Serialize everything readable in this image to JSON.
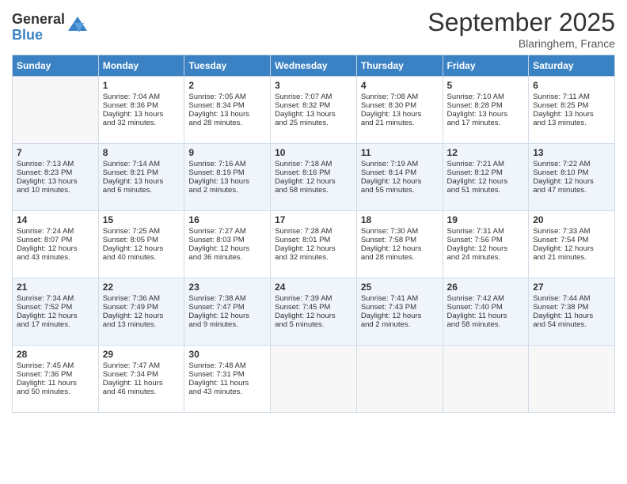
{
  "header": {
    "logo": {
      "general": "General",
      "blue": "Blue"
    },
    "month_title": "September 2025",
    "location": "Blaringhem, France"
  },
  "days_of_week": [
    "Sunday",
    "Monday",
    "Tuesday",
    "Wednesday",
    "Thursday",
    "Friday",
    "Saturday"
  ],
  "weeks": [
    [
      {
        "day": "",
        "info": ""
      },
      {
        "day": "1",
        "info": "Sunrise: 7:04 AM\nSunset: 8:36 PM\nDaylight: 13 hours\nand 32 minutes."
      },
      {
        "day": "2",
        "info": "Sunrise: 7:05 AM\nSunset: 8:34 PM\nDaylight: 13 hours\nand 28 minutes."
      },
      {
        "day": "3",
        "info": "Sunrise: 7:07 AM\nSunset: 8:32 PM\nDaylight: 13 hours\nand 25 minutes."
      },
      {
        "day": "4",
        "info": "Sunrise: 7:08 AM\nSunset: 8:30 PM\nDaylight: 13 hours\nand 21 minutes."
      },
      {
        "day": "5",
        "info": "Sunrise: 7:10 AM\nSunset: 8:28 PM\nDaylight: 13 hours\nand 17 minutes."
      },
      {
        "day": "6",
        "info": "Sunrise: 7:11 AM\nSunset: 8:25 PM\nDaylight: 13 hours\nand 13 minutes."
      }
    ],
    [
      {
        "day": "7",
        "info": "Sunrise: 7:13 AM\nSunset: 8:23 PM\nDaylight: 13 hours\nand 10 minutes."
      },
      {
        "day": "8",
        "info": "Sunrise: 7:14 AM\nSunset: 8:21 PM\nDaylight: 13 hours\nand 6 minutes."
      },
      {
        "day": "9",
        "info": "Sunrise: 7:16 AM\nSunset: 8:19 PM\nDaylight: 13 hours\nand 2 minutes."
      },
      {
        "day": "10",
        "info": "Sunrise: 7:18 AM\nSunset: 8:16 PM\nDaylight: 12 hours\nand 58 minutes."
      },
      {
        "day": "11",
        "info": "Sunrise: 7:19 AM\nSunset: 8:14 PM\nDaylight: 12 hours\nand 55 minutes."
      },
      {
        "day": "12",
        "info": "Sunrise: 7:21 AM\nSunset: 8:12 PM\nDaylight: 12 hours\nand 51 minutes."
      },
      {
        "day": "13",
        "info": "Sunrise: 7:22 AM\nSunset: 8:10 PM\nDaylight: 12 hours\nand 47 minutes."
      }
    ],
    [
      {
        "day": "14",
        "info": "Sunrise: 7:24 AM\nSunset: 8:07 PM\nDaylight: 12 hours\nand 43 minutes."
      },
      {
        "day": "15",
        "info": "Sunrise: 7:25 AM\nSunset: 8:05 PM\nDaylight: 12 hours\nand 40 minutes."
      },
      {
        "day": "16",
        "info": "Sunrise: 7:27 AM\nSunset: 8:03 PM\nDaylight: 12 hours\nand 36 minutes."
      },
      {
        "day": "17",
        "info": "Sunrise: 7:28 AM\nSunset: 8:01 PM\nDaylight: 12 hours\nand 32 minutes."
      },
      {
        "day": "18",
        "info": "Sunrise: 7:30 AM\nSunset: 7:58 PM\nDaylight: 12 hours\nand 28 minutes."
      },
      {
        "day": "19",
        "info": "Sunrise: 7:31 AM\nSunset: 7:56 PM\nDaylight: 12 hours\nand 24 minutes."
      },
      {
        "day": "20",
        "info": "Sunrise: 7:33 AM\nSunset: 7:54 PM\nDaylight: 12 hours\nand 21 minutes."
      }
    ],
    [
      {
        "day": "21",
        "info": "Sunrise: 7:34 AM\nSunset: 7:52 PM\nDaylight: 12 hours\nand 17 minutes."
      },
      {
        "day": "22",
        "info": "Sunrise: 7:36 AM\nSunset: 7:49 PM\nDaylight: 12 hours\nand 13 minutes."
      },
      {
        "day": "23",
        "info": "Sunrise: 7:38 AM\nSunset: 7:47 PM\nDaylight: 12 hours\nand 9 minutes."
      },
      {
        "day": "24",
        "info": "Sunrise: 7:39 AM\nSunset: 7:45 PM\nDaylight: 12 hours\nand 5 minutes."
      },
      {
        "day": "25",
        "info": "Sunrise: 7:41 AM\nSunset: 7:43 PM\nDaylight: 12 hours\nand 2 minutes."
      },
      {
        "day": "26",
        "info": "Sunrise: 7:42 AM\nSunset: 7:40 PM\nDaylight: 11 hours\nand 58 minutes."
      },
      {
        "day": "27",
        "info": "Sunrise: 7:44 AM\nSunset: 7:38 PM\nDaylight: 11 hours\nand 54 minutes."
      }
    ],
    [
      {
        "day": "28",
        "info": "Sunrise: 7:45 AM\nSunset: 7:36 PM\nDaylight: 11 hours\nand 50 minutes."
      },
      {
        "day": "29",
        "info": "Sunrise: 7:47 AM\nSunset: 7:34 PM\nDaylight: 11 hours\nand 46 minutes."
      },
      {
        "day": "30",
        "info": "Sunrise: 7:48 AM\nSunset: 7:31 PM\nDaylight: 11 hours\nand 43 minutes."
      },
      {
        "day": "",
        "info": ""
      },
      {
        "day": "",
        "info": ""
      },
      {
        "day": "",
        "info": ""
      },
      {
        "day": "",
        "info": ""
      }
    ]
  ]
}
